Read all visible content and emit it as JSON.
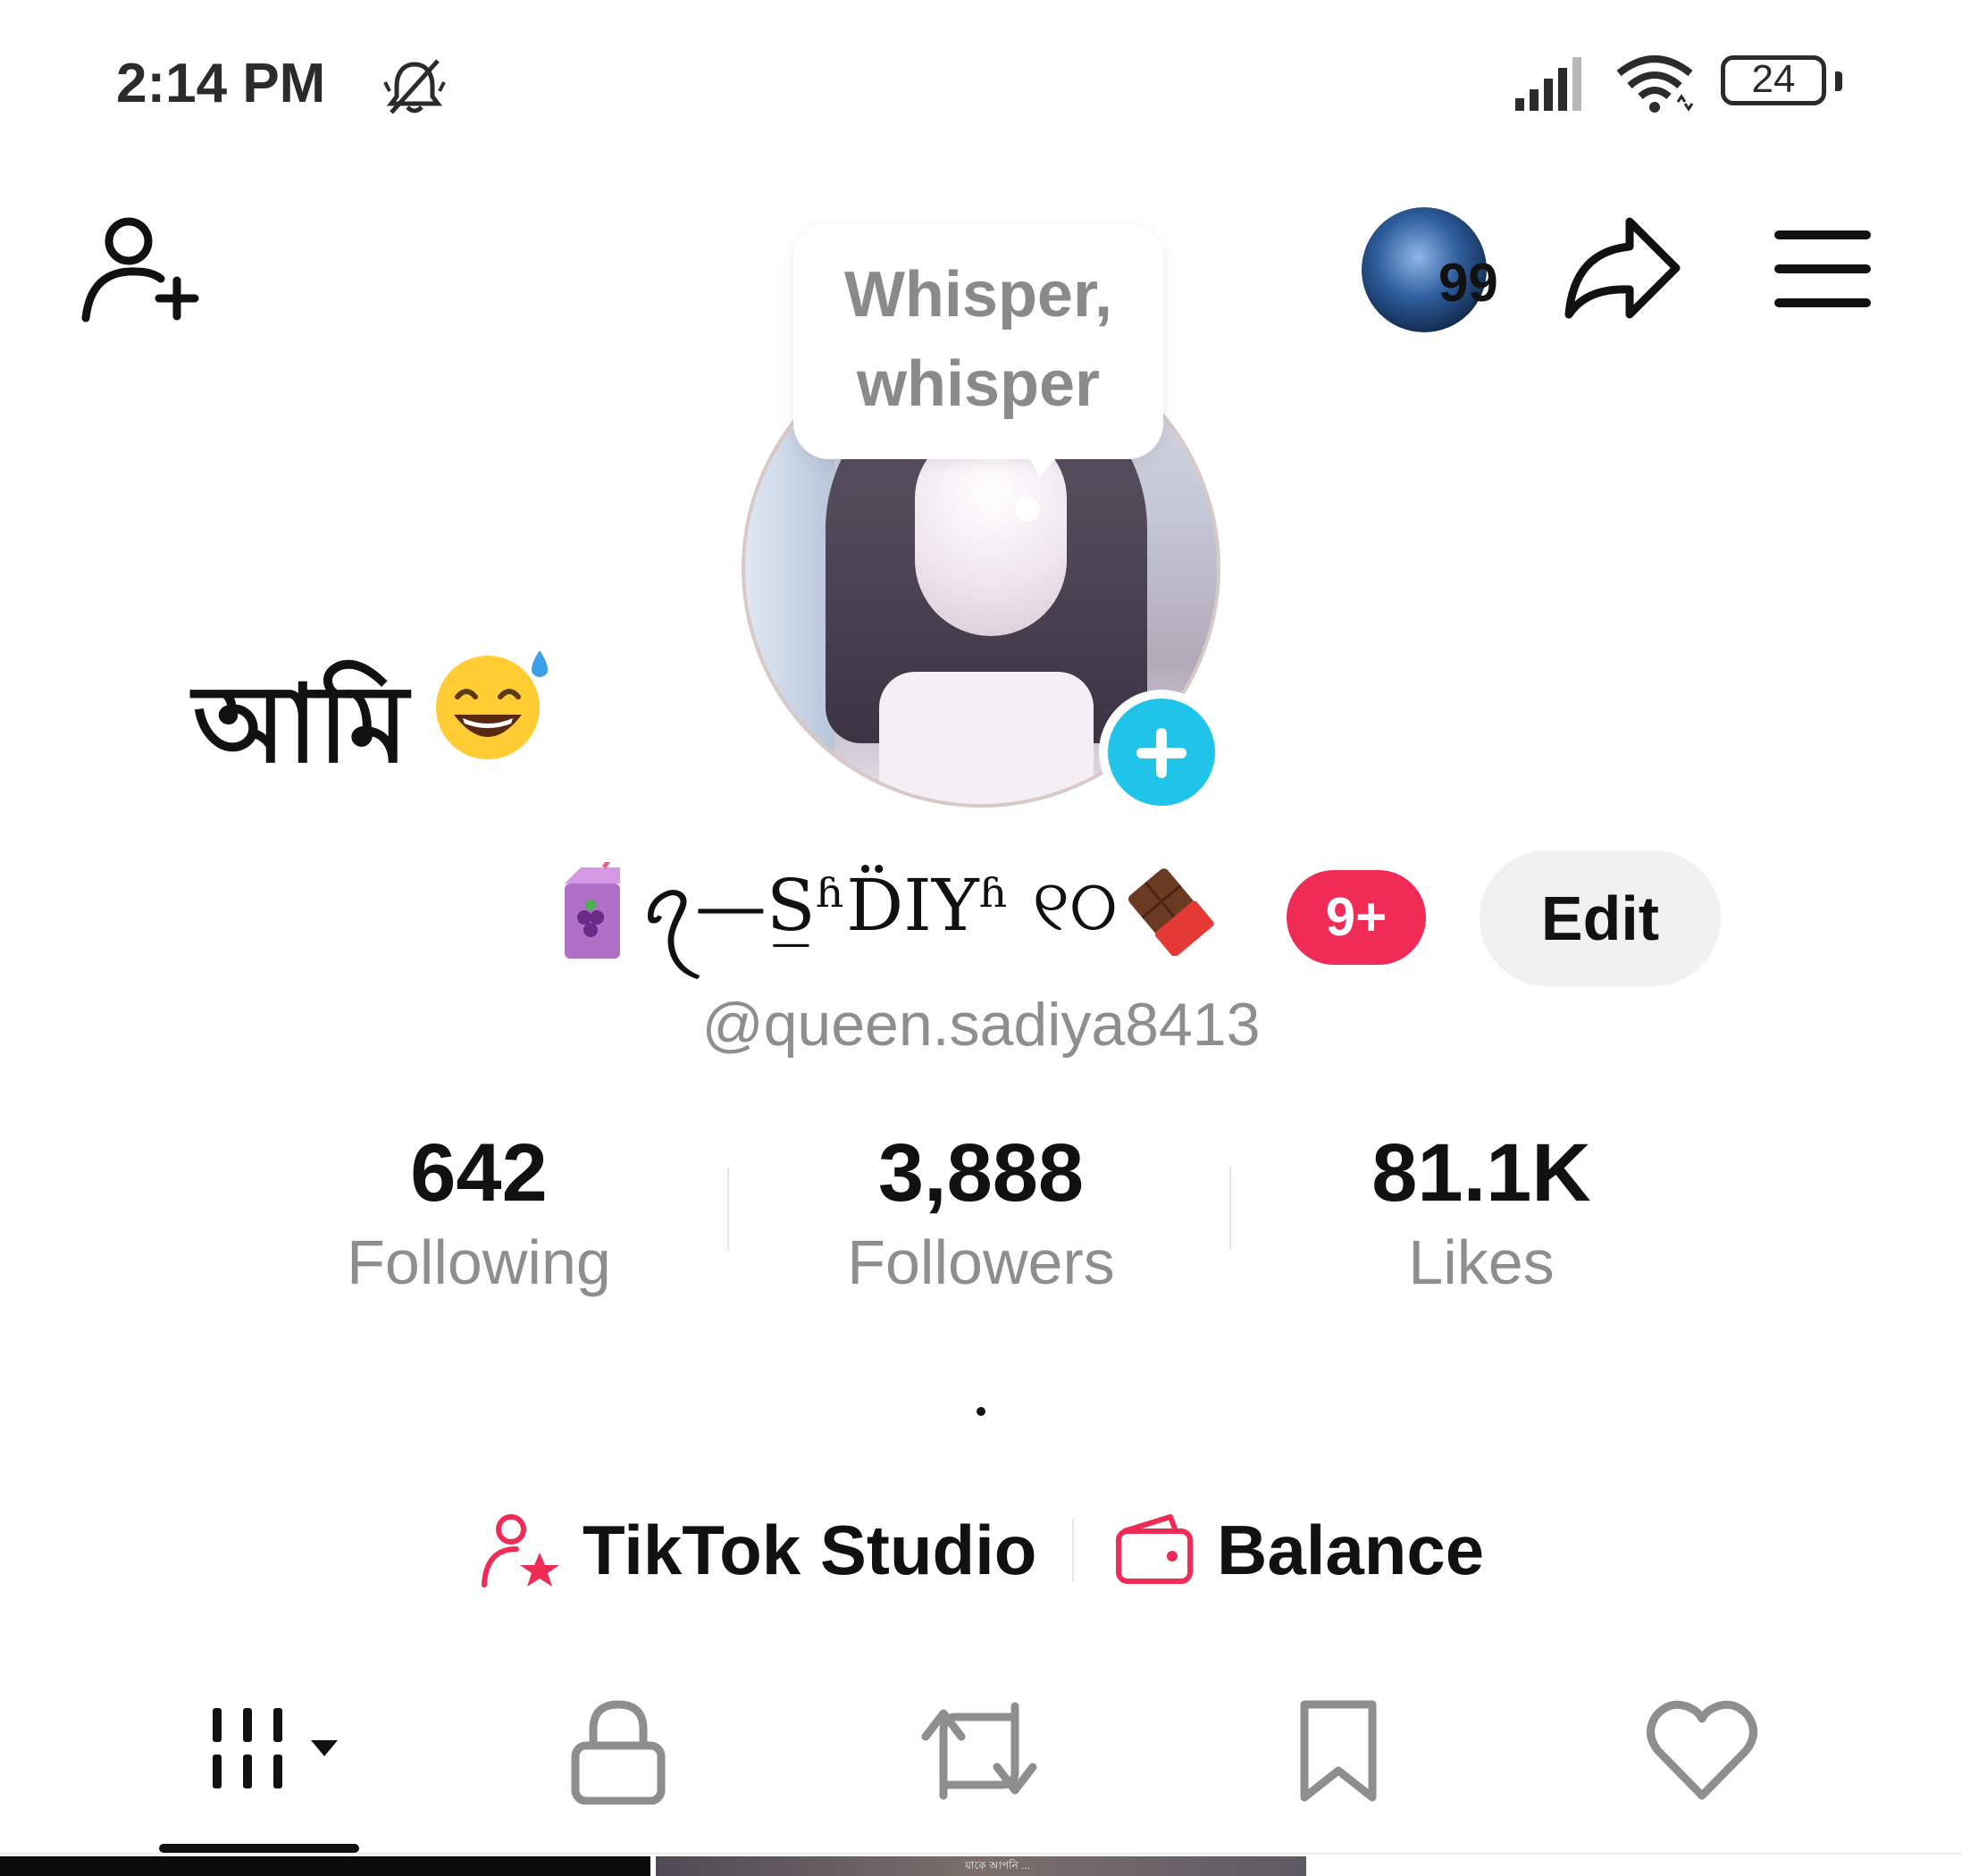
{
  "status_bar": {
    "time": "2:14 PM",
    "battery": "24",
    "icons": [
      "bell-muted-icon",
      "signal-icon",
      "wifi-icon",
      "battery-icon"
    ]
  },
  "header": {
    "badge_count": "99",
    "icons": [
      "add-user-icon",
      "share-icon",
      "menu-icon"
    ]
  },
  "avatar": {
    "bubble_text": "Whisper,\nwhisper",
    "add_icon": "plus-icon"
  },
  "status_note": {
    "text": "আমি",
    "emoji": "grinning-sweat-emoji"
  },
  "profile": {
    "display_name": "ꪖ—S̲ʱD̈IYʱ ୧ଠ",
    "notification_badge": "9+",
    "edit_label": "Edit",
    "username": "@queen.sadiya8413"
  },
  "stats": [
    {
      "value": "642",
      "label": "Following"
    },
    {
      "value": "3,888",
      "label": "Followers"
    },
    {
      "value": "81.1K",
      "label": "Likes"
    }
  ],
  "bio": ".",
  "tools": {
    "studio_label": "TikTok Studio",
    "balance_label": "Balance"
  },
  "tabs": [
    "videos-grid-icon",
    "lock-icon",
    "repost-icon",
    "bookmark-icon",
    "heart-icon"
  ],
  "thumbnail_caption": "যাকে আপনি ...",
  "colors": {
    "accent_red": "#f02b55",
    "accent_cyan": "#20c4e8",
    "muted_text": "#8e8e8e"
  }
}
